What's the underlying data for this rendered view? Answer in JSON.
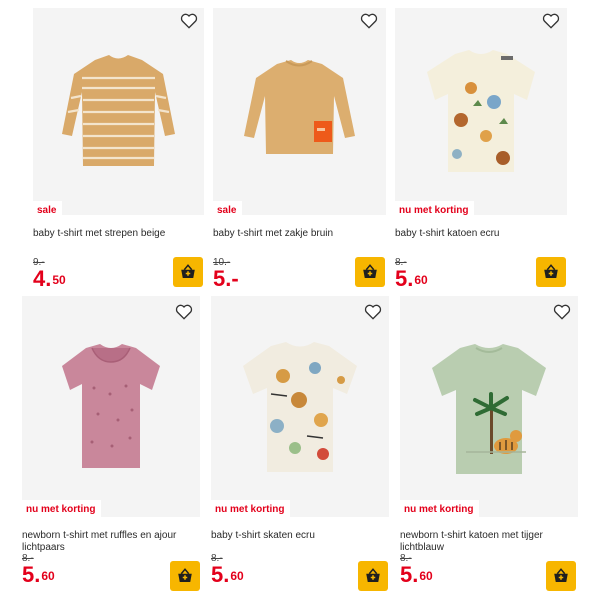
{
  "colors": {
    "accent": "#e3001b",
    "cart_button": "#f7b600",
    "image_bg": "#f4f4f4"
  },
  "icons": {
    "favorite": "heart-icon",
    "cart": "basket-icon"
  },
  "products": [
    {
      "badge": "sale",
      "name": "baby t-shirt met strepen beige",
      "old_price": "9.-",
      "price_main": "4.",
      "price_cents": "50"
    },
    {
      "badge": "sale",
      "name": "baby t-shirt met zakje bruin",
      "old_price": "10.-",
      "price_main": "5.",
      "price_cents": "-"
    },
    {
      "badge": "nu met korting",
      "name": "baby t-shirt katoen ecru",
      "old_price": "8.-",
      "price_main": "5.",
      "price_cents": "60"
    },
    {
      "badge": "nu met korting",
      "name": "newborn t-shirt met ruffles en ajour lichtpaars",
      "old_price": "8.-",
      "price_main": "5.",
      "price_cents": "60"
    },
    {
      "badge": "nu met korting",
      "name": "baby t-shirt skaten ecru",
      "old_price": "8.-",
      "price_main": "5.",
      "price_cents": "60"
    },
    {
      "badge": "nu met korting",
      "name": "newborn t-shirt katoen met tijger lichtblauw",
      "old_price": "8.-",
      "price_main": "5.",
      "price_cents": "60"
    }
  ]
}
